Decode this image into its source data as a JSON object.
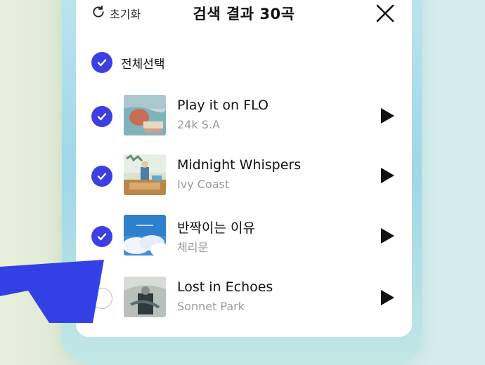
{
  "header": {
    "reset_label": "초기화",
    "title": "검색 결과 30곡"
  },
  "select_all": {
    "label": "전체선택",
    "checked": true
  },
  "tracks": [
    {
      "title": "Play it on FLO",
      "artist": "24k S.A",
      "checked": true
    },
    {
      "title": "Midnight Whispers",
      "artist": "Ivy Coast",
      "checked": true
    },
    {
      "title": "반짝이는 이유",
      "artist": "체리문",
      "checked": true
    },
    {
      "title": "Lost in Echoes",
      "artist": "Sonnet Park",
      "checked": false
    }
  ],
  "colors": {
    "accent": "#3d3fe3",
    "flag": "#3340e6"
  }
}
